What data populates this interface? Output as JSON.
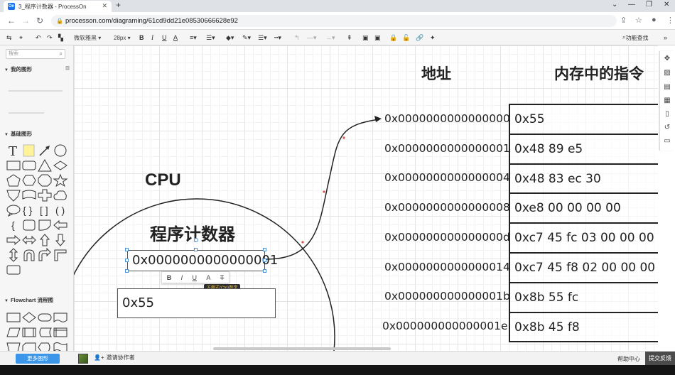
{
  "browser": {
    "tab_title": "3_程序计数器 - ProcessOn",
    "tab_favicon": "On",
    "new_tab": "+",
    "url": "processon.com/diagraming/61cd9dd21e08530666628e92",
    "window_controls": [
      "⌄",
      "—",
      "❐",
      "✕"
    ]
  },
  "toolbar": {
    "font_family": "微软雅黑",
    "font_size": "28px",
    "bold": "B",
    "italic": "I",
    "underline": "U",
    "font_color": "A",
    "feature_search": "功能查找"
  },
  "left_panel": {
    "search_placeholder": "搜索",
    "my_shapes": "我的图形",
    "basic_shapes": "基础图形",
    "flowchart": "Flowchart 流程图",
    "more_shapes": "更多图形"
  },
  "bottom_bar": {
    "invite": "邀请协作者",
    "help": "帮助中心",
    "feedback": "提交反馈"
  },
  "diagram": {
    "cpu_label": "CPU",
    "pc_label": "程序计数器",
    "pc_value": "0x0000000000000001",
    "ir_value": "0x55",
    "text_toolbar": [
      "B",
      "I",
      "U",
      "A",
      "T"
    ],
    "tooltip": "方程式(Ctrl)数学",
    "address_header": "地址",
    "memory_header": "内存中的指令",
    "rows": [
      {
        "address": "0x0000000000000000",
        "instruction": "0x55"
      },
      {
        "address": "0x0000000000000001",
        "instruction": "0x48 89 e5"
      },
      {
        "address": "0x0000000000000004",
        "instruction": "0x48 83 ec 30"
      },
      {
        "address": "0x0000000000000008",
        "instruction": "0xe8 00 00 00 00"
      },
      {
        "address": "0x000000000000000d",
        "instruction": "0xc7 45 fc 03 00 00 00"
      },
      {
        "address": "0x0000000000000014",
        "instruction": "0xc7 45 f8 02 00 00 00"
      },
      {
        "address": "0x000000000000001b",
        "instruction": "0x8b 55 fc"
      },
      {
        "address": "0x000000000000001e",
        "instruction": "0x8b 45 f8"
      }
    ]
  },
  "colors": {
    "accent_blue": "#3b95e8",
    "feedback_bg": "#4b4b4b",
    "selection": "#4a90d9"
  }
}
